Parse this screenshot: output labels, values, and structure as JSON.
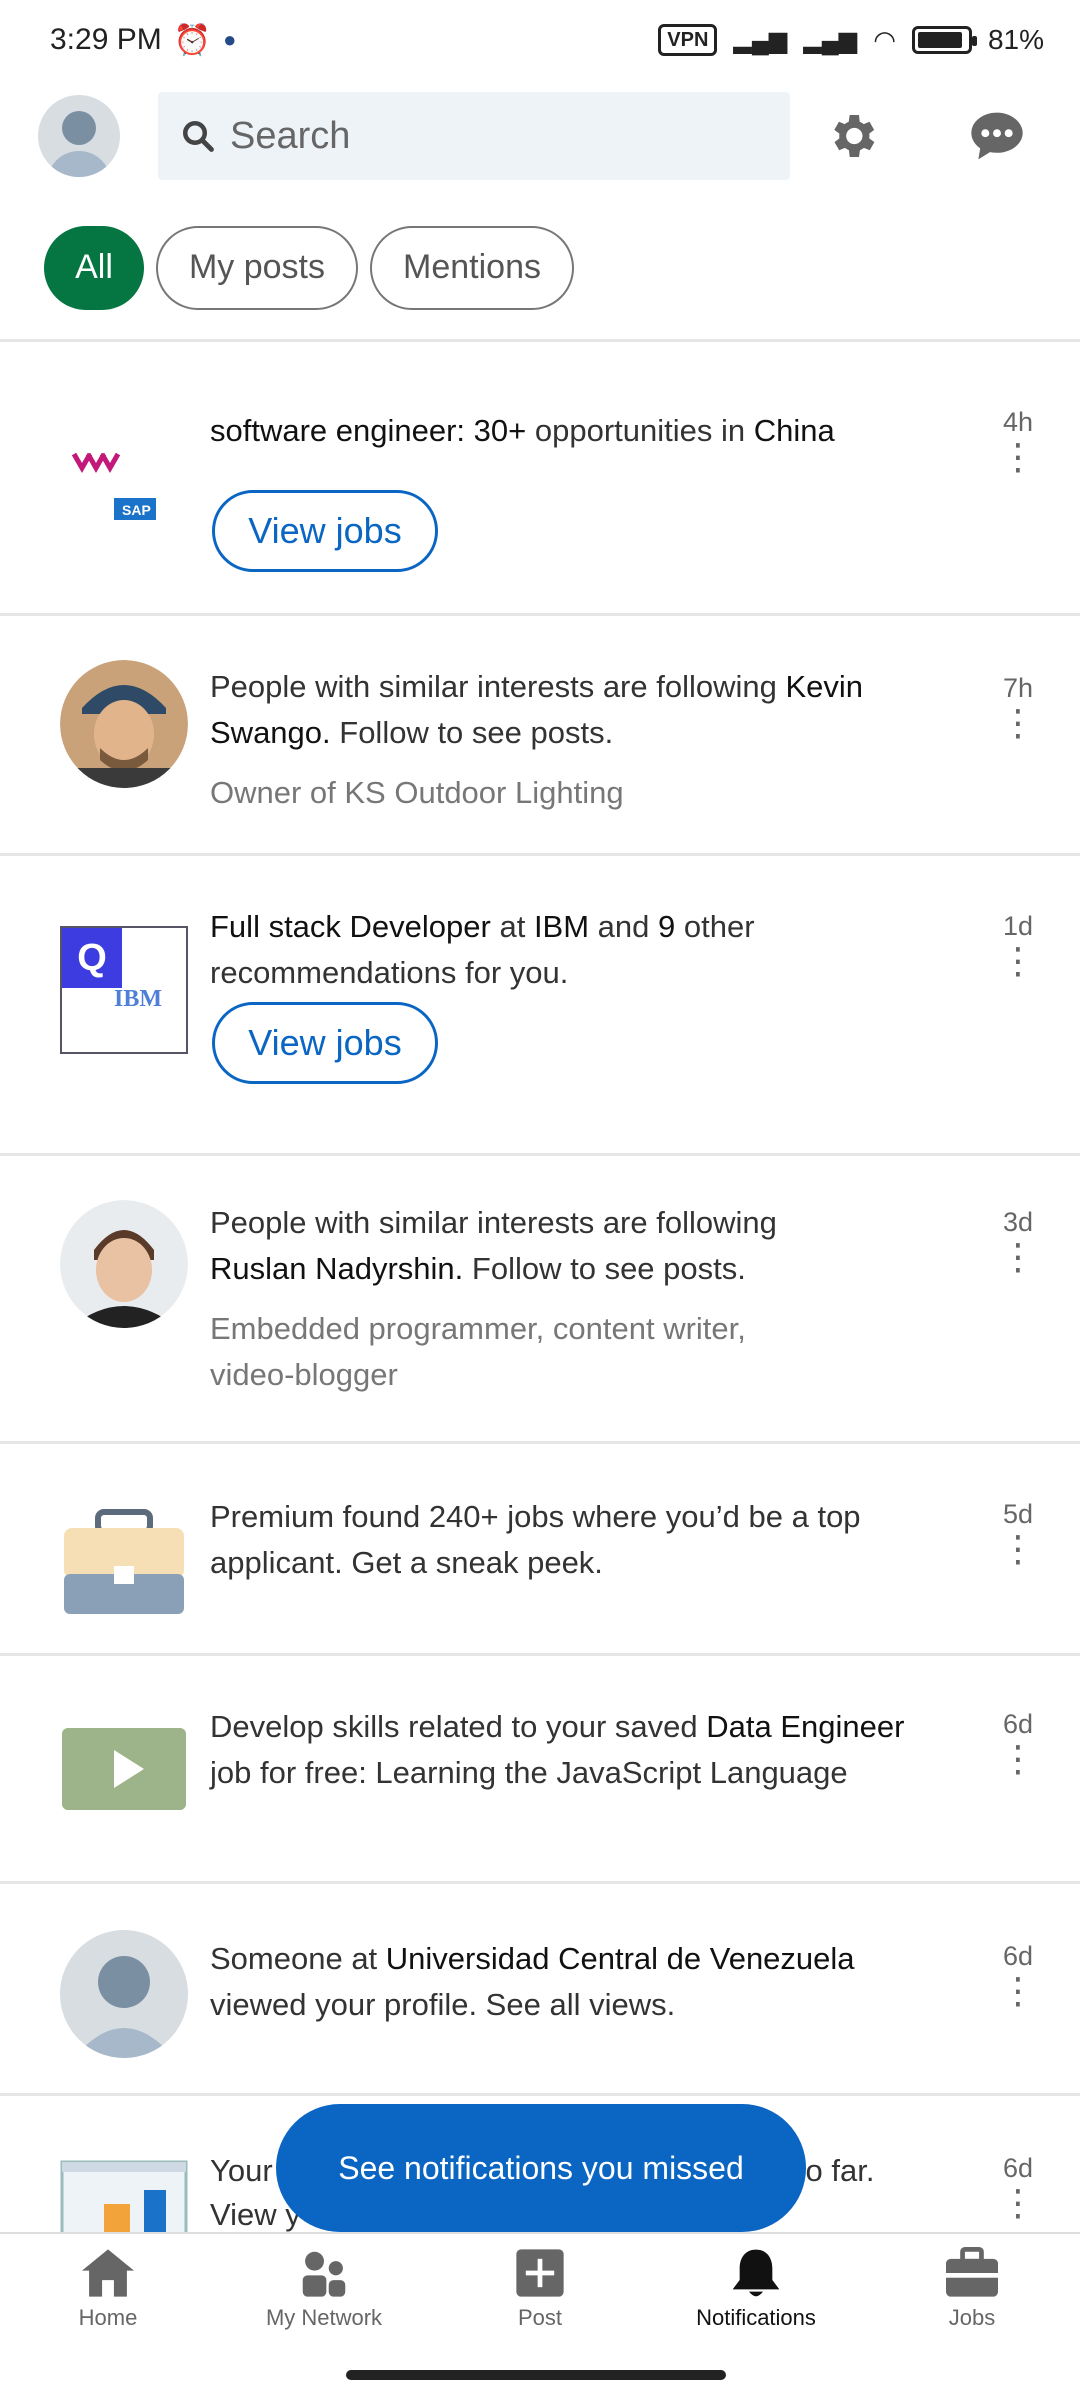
{
  "status_bar": {
    "time": "3:29 PM",
    "vpn": "VPN",
    "battery": "81%"
  },
  "header": {
    "search_placeholder": "Search"
  },
  "chips": [
    {
      "label": "All"
    },
    {
      "label": "My posts"
    },
    {
      "label": "Mentions"
    }
  ],
  "notifications": [
    {
      "text_a": "software engineer: 30+",
      "text_b": " opportunities in ",
      "text_c": "China",
      "button": "View jobs",
      "time": "4h"
    },
    {
      "text_a": "People with similar interests are following ",
      "text_b": "Kevin Swango.",
      "text_c": " Follow to see posts.",
      "sub": "Owner of KS Outdoor Lighting",
      "time": "7h"
    },
    {
      "text_a": "Full stack Developer",
      "text_b": " at ",
      "text_c": "IBM",
      "text_d": " and ",
      "text_e": "9",
      "text_f": " other recommendations for you.",
      "button": "View jobs",
      "time": "1d",
      "logo": "IBM"
    },
    {
      "text_a": "People with similar interests are following ",
      "text_b": "Ruslan Nadyrshin.",
      "text_c": " Follow to see posts.",
      "sub": "Embedded programmer, content writer, video-blogger",
      "time": "3d"
    },
    {
      "text": "Premium found 240+ jobs where you’d be a top applicant. Get a sneak peek.",
      "time": "5d"
    },
    {
      "text_a": "Develop skills related to your saved ",
      "text_b": "Data Engineer",
      "text_c": " job for free: Learning the JavaScript Language",
      "time": "6d"
    },
    {
      "text_a": "Someone at ",
      "text_b": "Universidad Central de Venezuela",
      "text_c": " viewed your profile. See all views.",
      "time": "6d"
    },
    {
      "text_a": "Your",
      "text_b": "so far.",
      "text_c": "View y",
      "time": "6d"
    }
  ],
  "pill": "See notifications you missed",
  "bottom_nav": [
    {
      "label": "Home"
    },
    {
      "label": "My Network"
    },
    {
      "label": "Post"
    },
    {
      "label": "Notifications"
    },
    {
      "label": "Jobs"
    }
  ],
  "colors": {
    "brand_blue": "#0a66c2",
    "active_green": "#057642"
  }
}
